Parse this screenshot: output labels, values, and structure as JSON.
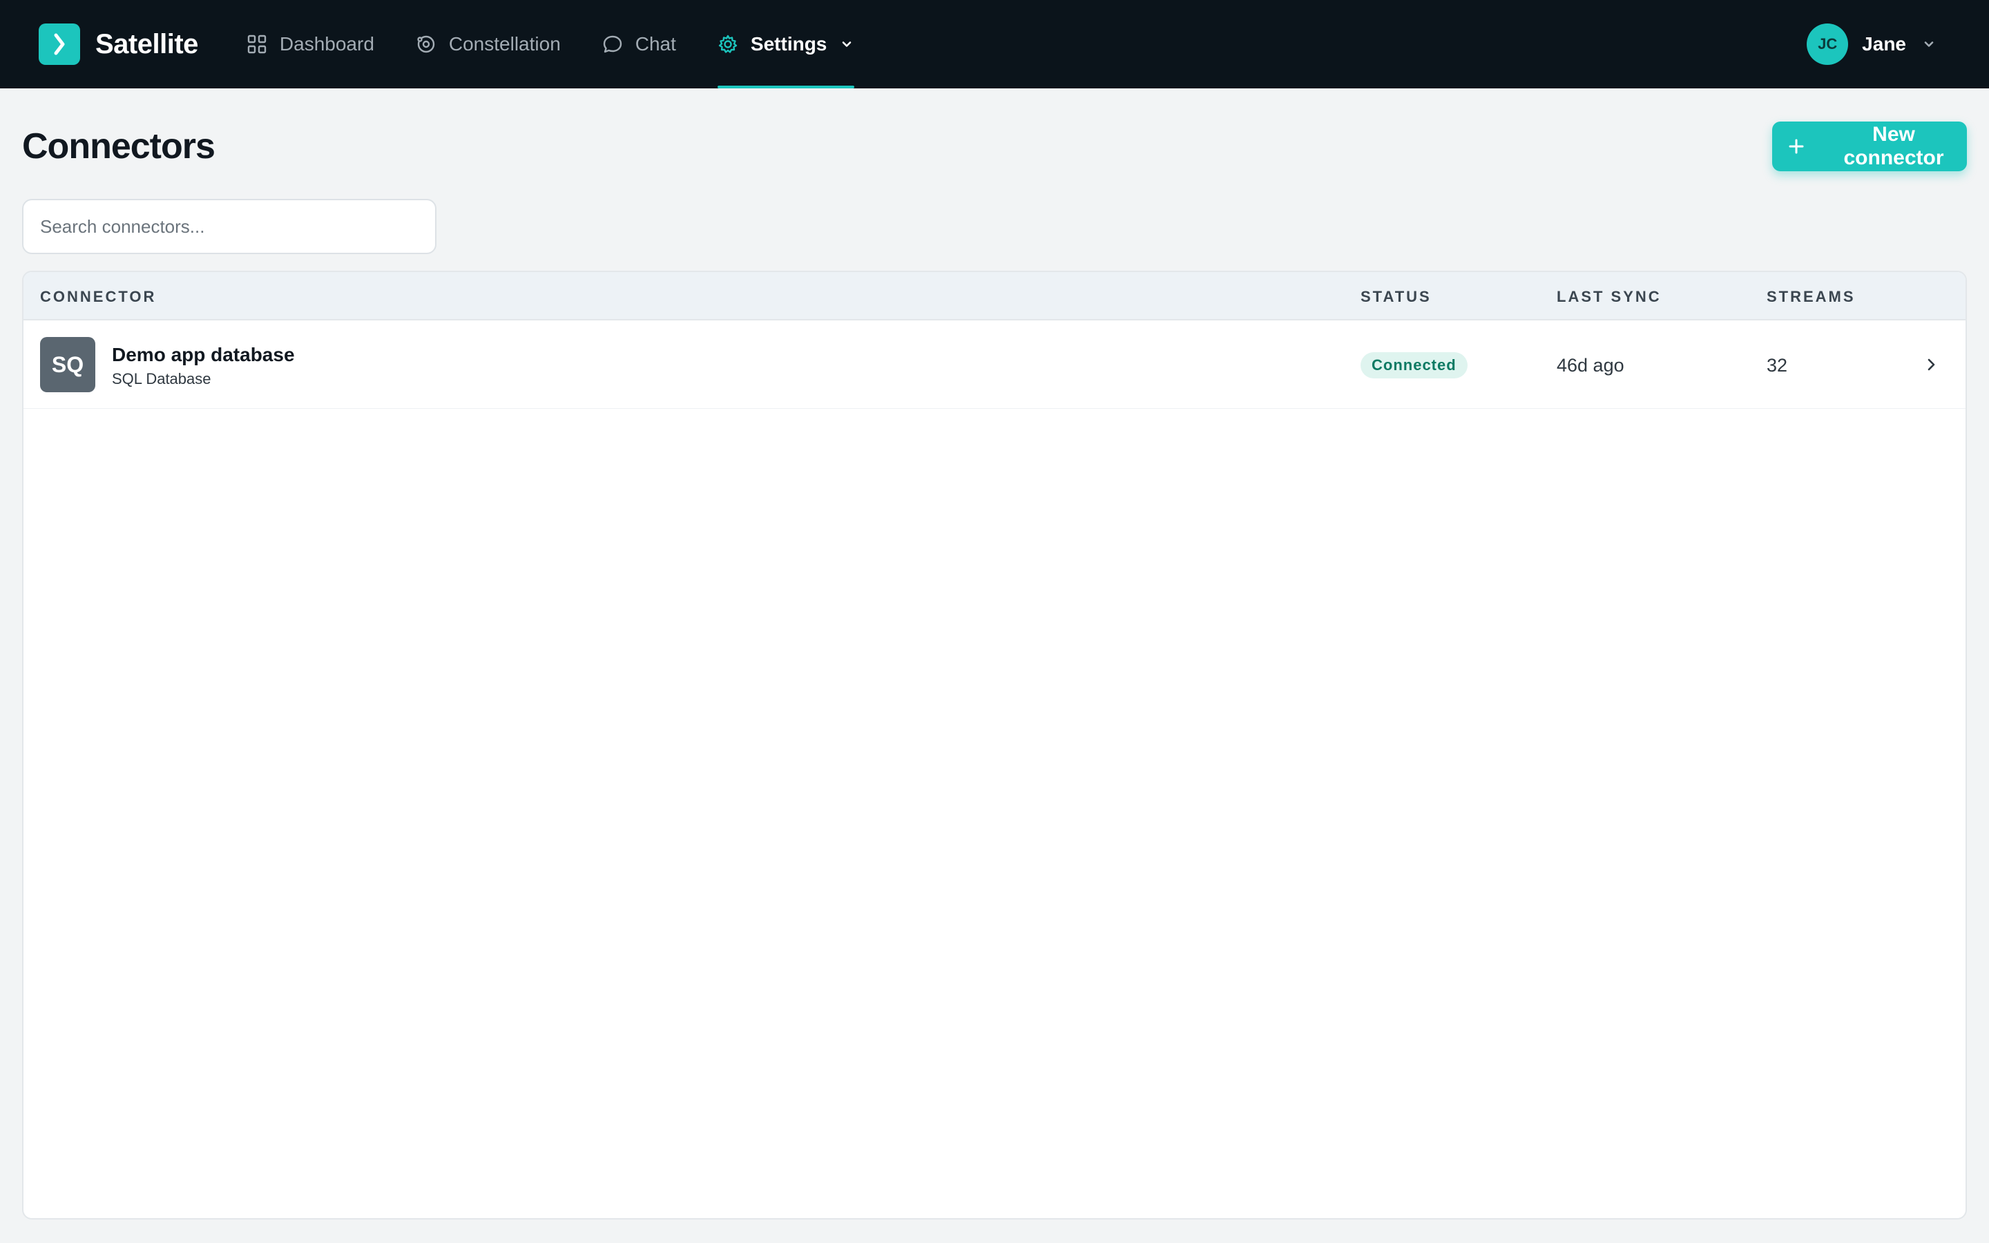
{
  "app": {
    "brand": "Satellite"
  },
  "nav": {
    "items": [
      {
        "label": "Dashboard",
        "icon": "grid-icon"
      },
      {
        "label": "Constellation",
        "icon": "orbit-icon"
      },
      {
        "label": "Chat",
        "icon": "chat-bubble-icon"
      },
      {
        "label": "Settings",
        "icon": "gear-icon",
        "active": true
      }
    ]
  },
  "user": {
    "initials": "JC",
    "name": "Jane"
  },
  "page": {
    "title": "Connectors",
    "new_button_label": "New connector"
  },
  "search": {
    "placeholder": "Search connectors...",
    "value": ""
  },
  "table": {
    "columns": [
      "CONNECTOR",
      "STATUS",
      "LAST SYNC",
      "STREAMS"
    ],
    "rows": [
      {
        "icon_text": "SQ",
        "name": "Demo app database",
        "type": "SQL Database",
        "status": "Connected",
        "last_sync": "46d ago",
        "streams": "32"
      }
    ]
  },
  "colors": {
    "accent": "#1cc5bd",
    "topbar": "#0b141b",
    "status_connected_bg": "#dff4ef",
    "status_connected_text": "#0c7a63"
  }
}
